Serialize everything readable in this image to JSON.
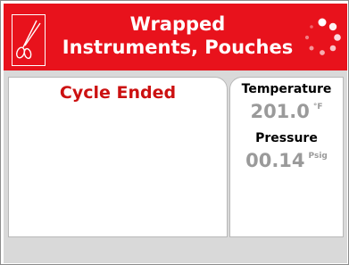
{
  "header": {
    "title_line1": "Wrapped",
    "title_line2": "Instruments, Pouches",
    "icon": "scissors-icon",
    "busy_indicator": "spinner-icon",
    "background_color": "#e8121c"
  },
  "status": {
    "text": "Cycle Ended",
    "color": "#cc1111"
  },
  "metrics": {
    "temperature": {
      "label": "Temperature",
      "value": "201.0",
      "unit": "°F"
    },
    "pressure": {
      "label": "Pressure",
      "value": "00.14",
      "unit": "Psig"
    }
  }
}
